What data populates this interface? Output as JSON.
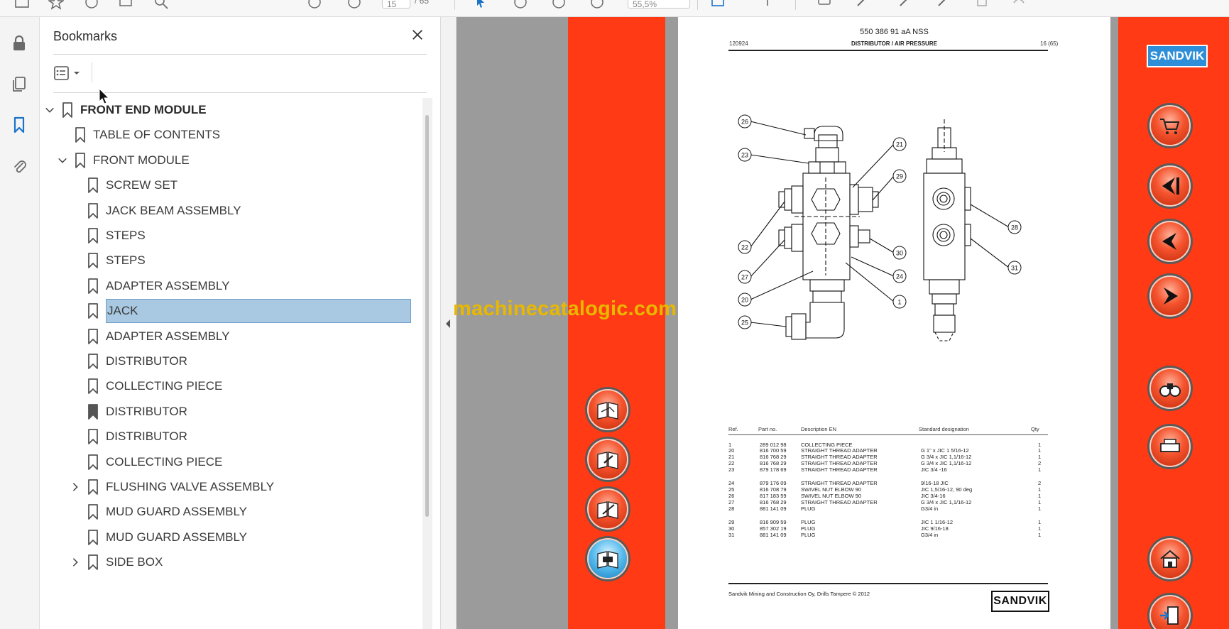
{
  "panel": {
    "title": "Bookmarks",
    "close_icon": "close-icon",
    "options_icon": "bookmark-options-icon"
  },
  "toolbar": {
    "page_number": "15",
    "page_total": "/ 65",
    "zoom": "55,5%"
  },
  "bookmarks": [
    {
      "label": "FRONT END MODULE",
      "level": 0,
      "toggle": "expanded"
    },
    {
      "label": "TABLE OF CONTENTS",
      "level": 1,
      "toggle": "none"
    },
    {
      "label": "FRONT MODULE",
      "level": 1,
      "toggle": "expanded"
    },
    {
      "label": "SCREW SET",
      "level": 2,
      "toggle": "none"
    },
    {
      "label": "JACK BEAM ASSEMBLY",
      "level": 2,
      "toggle": "none"
    },
    {
      "label": "STEPS",
      "level": 2,
      "toggle": "none"
    },
    {
      "label": "STEPS",
      "level": 2,
      "toggle": "none"
    },
    {
      "label": "ADAPTER ASSEMBLY",
      "level": 2,
      "toggle": "none"
    },
    {
      "label": "JACK",
      "level": 2,
      "toggle": "none",
      "selected": true
    },
    {
      "label": "ADAPTER ASSEMBLY",
      "level": 2,
      "toggle": "none"
    },
    {
      "label": "DISTRIBUTOR",
      "level": 2,
      "toggle": "none"
    },
    {
      "label": "COLLECTING PIECE",
      "level": 2,
      "toggle": "none"
    },
    {
      "label": "DISTRIBUTOR",
      "level": 2,
      "toggle": "none",
      "current": true
    },
    {
      "label": "DISTRIBUTOR",
      "level": 2,
      "toggle": "none"
    },
    {
      "label": "COLLECTING PIECE",
      "level": 2,
      "toggle": "none"
    },
    {
      "label": "FLUSHING VALVE ASSEMBLY",
      "level": 2,
      "toggle": "collapsed"
    },
    {
      "label": "MUD GUARD ASSEMBLY",
      "level": 2,
      "toggle": "none"
    },
    {
      "label": "MUD GUARD ASSEMBLY",
      "level": 2,
      "toggle": "none"
    },
    {
      "label": "SIDE BOX",
      "level": 2,
      "toggle": "collapsed"
    }
  ],
  "page": {
    "doc_number": "550 386 91 aA NSS",
    "code": "120924",
    "title": "DISTRIBUTOR / AIR PRESSURE",
    "page_label": "16 (65)",
    "columns": [
      "Ref.",
      "Part no.",
      "Description EN",
      "Standard designation",
      "Qty"
    ],
    "rows": [
      {
        "ref": "1",
        "part": "289 012 98",
        "desc": "COLLECTING PIECE",
        "std": "",
        "qty": "1"
      },
      {
        "ref": "20",
        "part": "816 700 59",
        "desc": "STRAIGHT THREAD ADAPTER",
        "std": "G 1\" x JIC 1 5/16-12",
        "qty": "1"
      },
      {
        "ref": "21",
        "part": "816 768 29",
        "desc": "STRAIGHT THREAD ADAPTER",
        "std": "G 3/4 x JIC 1,1/16-12",
        "qty": "1"
      },
      {
        "ref": "22",
        "part": "816 768 29",
        "desc": "STRAIGHT THREAD ADAPTER",
        "std": "G 3/4 x JIC 1,1/16-12",
        "qty": "2"
      },
      {
        "ref": "23",
        "part": "879 178 69",
        "desc": "STRAIGHT THREAD ADAPTER",
        "std": "JIC 3/4 -16",
        "qty": "1"
      },
      {
        "ref": "24",
        "part": "879 176 09",
        "desc": "STRAIGHT THREAD ADAPTER",
        "std": "9/16-18 JIC",
        "qty": "2"
      },
      {
        "ref": "25",
        "part": "816 708 79",
        "desc": "SWIVEL NUT ELBOW 90",
        "std": "JIC 1,5/16-12, 90 deg",
        "qty": "1"
      },
      {
        "ref": "26",
        "part": "817 183 59",
        "desc": "SWIVEL NUT ELBOW 90",
        "std": "JIC 3/4-16",
        "qty": "1"
      },
      {
        "ref": "27",
        "part": "816 768 29",
        "desc": "STRAIGHT THREAD ADAPTER",
        "std": "G 3/4 x JIC 1,1/16-12",
        "qty": "1"
      },
      {
        "ref": "28",
        "part": "881 141 09",
        "desc": "PLUG",
        "std": "G3/4 in",
        "qty": "1"
      },
      {
        "ref": "29",
        "part": "816 909 59",
        "desc": "PLUG",
        "std": "JIC 1 1/16-12",
        "qty": "1"
      },
      {
        "ref": "30",
        "part": "857 302 19",
        "desc": "PLUG",
        "std": "JIC 9/16-18",
        "qty": "1"
      },
      {
        "ref": "31",
        "part": "881 141 09",
        "desc": "PLUG",
        "std": "G3/4 in",
        "qty": "1"
      }
    ],
    "footer": "Sandvik Mining and Construction Oy, Drills Tampere © 2012",
    "logo_text": "SANDVIK",
    "callouts": [
      "26",
      "23",
      "21",
      "29",
      "22",
      "30",
      "27",
      "24",
      "20",
      "1",
      "25",
      "28",
      "31"
    ]
  },
  "brand_logo": "SANDVIK",
  "left_nav_icons": [
    "book-hand-icon",
    "book-wrench-icon",
    "book-pencil-icon",
    "book-active-icon"
  ],
  "right_nav_icons": [
    "cart-icon",
    "first-page-icon",
    "previous-page-icon",
    "next-page-icon",
    "binoculars-icon",
    "print-icon",
    "home-icon",
    "exit-icon"
  ],
  "watermark": "machinecatalogic.com",
  "colors": {
    "accent_red": "#ff3a14",
    "selected_bookmark": "#a9c9e2",
    "bookmark_icon_active": "#1a73c9",
    "watermark": "#e8b800"
  }
}
